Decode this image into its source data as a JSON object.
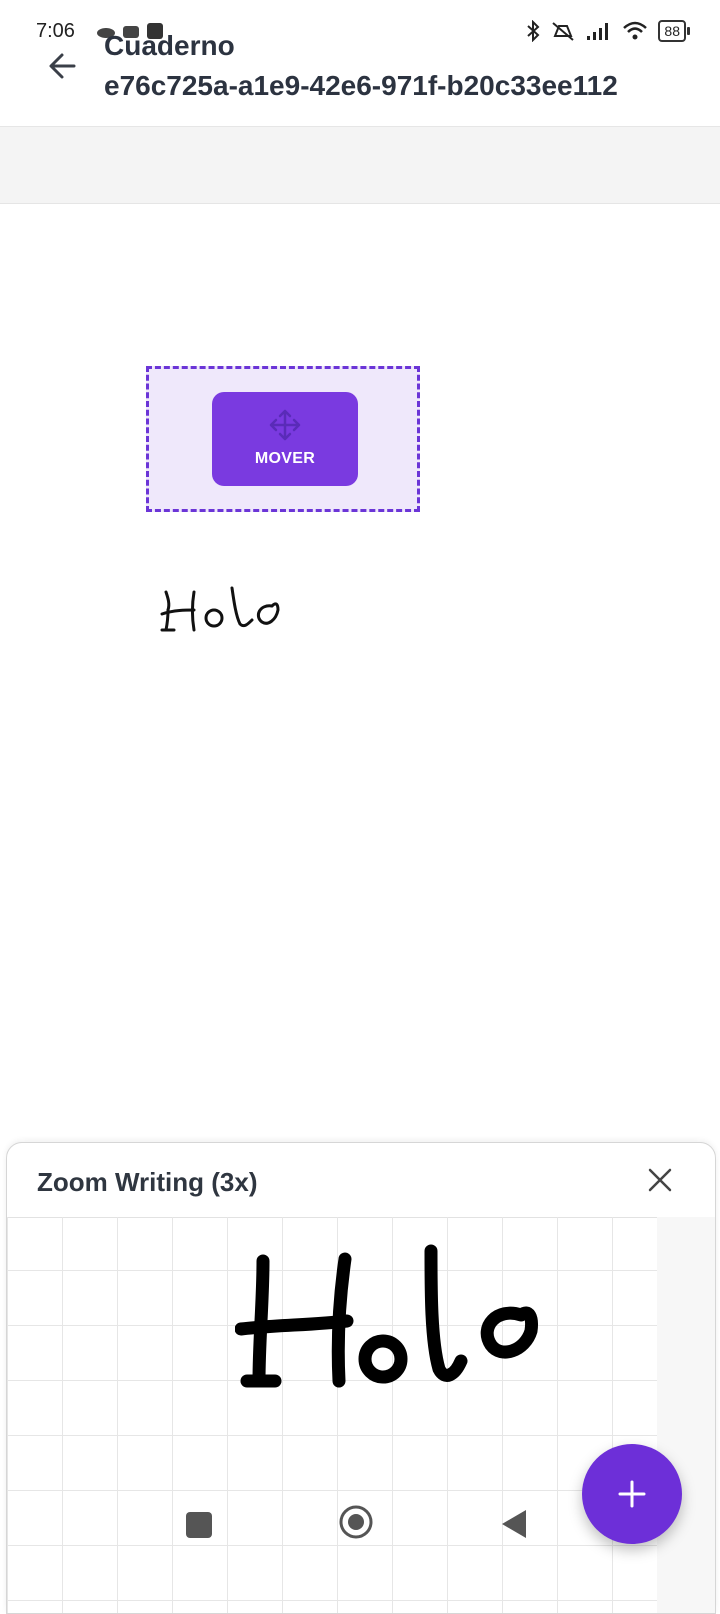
{
  "status_bar": {
    "time": "7:06",
    "battery": "88"
  },
  "header": {
    "title_line1": "Cuaderno",
    "title_line2": "e76c725a-a1e9-42e6-971f-b20c33ee112"
  },
  "canvas": {
    "mover_label": "MOVER"
  },
  "zoom_panel": {
    "title": "Zoom Writing (3x)"
  },
  "colors": {
    "accent": "#7a3ae0",
    "selection_bg": "#efe8fb",
    "text": "#2c3340"
  },
  "icons": [
    "back-arrow-icon",
    "move-icon",
    "close-icon",
    "plus-icon",
    "bluetooth-icon",
    "wifi-icon",
    "signal-icon",
    "battery-icon"
  ]
}
